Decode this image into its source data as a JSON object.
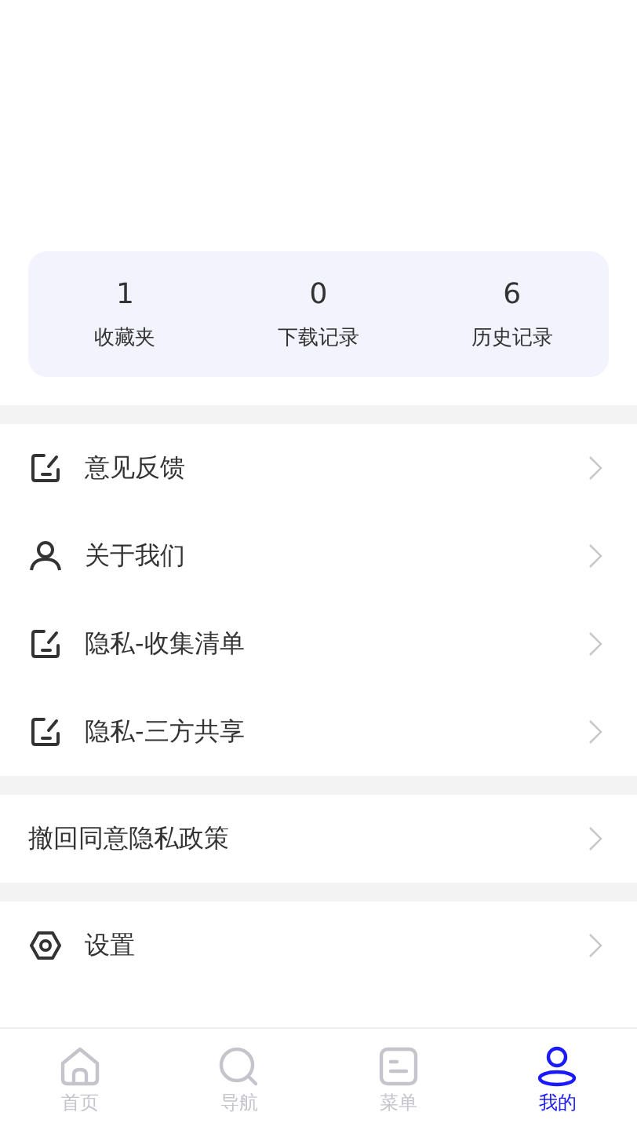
{
  "stats": [
    {
      "value": "1",
      "label": "收藏夹"
    },
    {
      "value": "0",
      "label": "下载记录"
    },
    {
      "value": "6",
      "label": "历史记录"
    }
  ],
  "menu_sections": [
    {
      "items": [
        {
          "label": "意见反馈"
        },
        {
          "label": "关于我们"
        },
        {
          "label": "隐私-收集清单"
        },
        {
          "label": "隐私-三方共享"
        }
      ]
    },
    {
      "items": [
        {
          "label": "撤回同意隐私政策"
        }
      ]
    },
    {
      "items": [
        {
          "label": "设置"
        }
      ]
    }
  ],
  "tabs": [
    {
      "label": "首页",
      "selected": false
    },
    {
      "label": "导航",
      "selected": false
    },
    {
      "label": "菜单",
      "selected": false
    },
    {
      "label": "我的",
      "selected": true
    }
  ]
}
